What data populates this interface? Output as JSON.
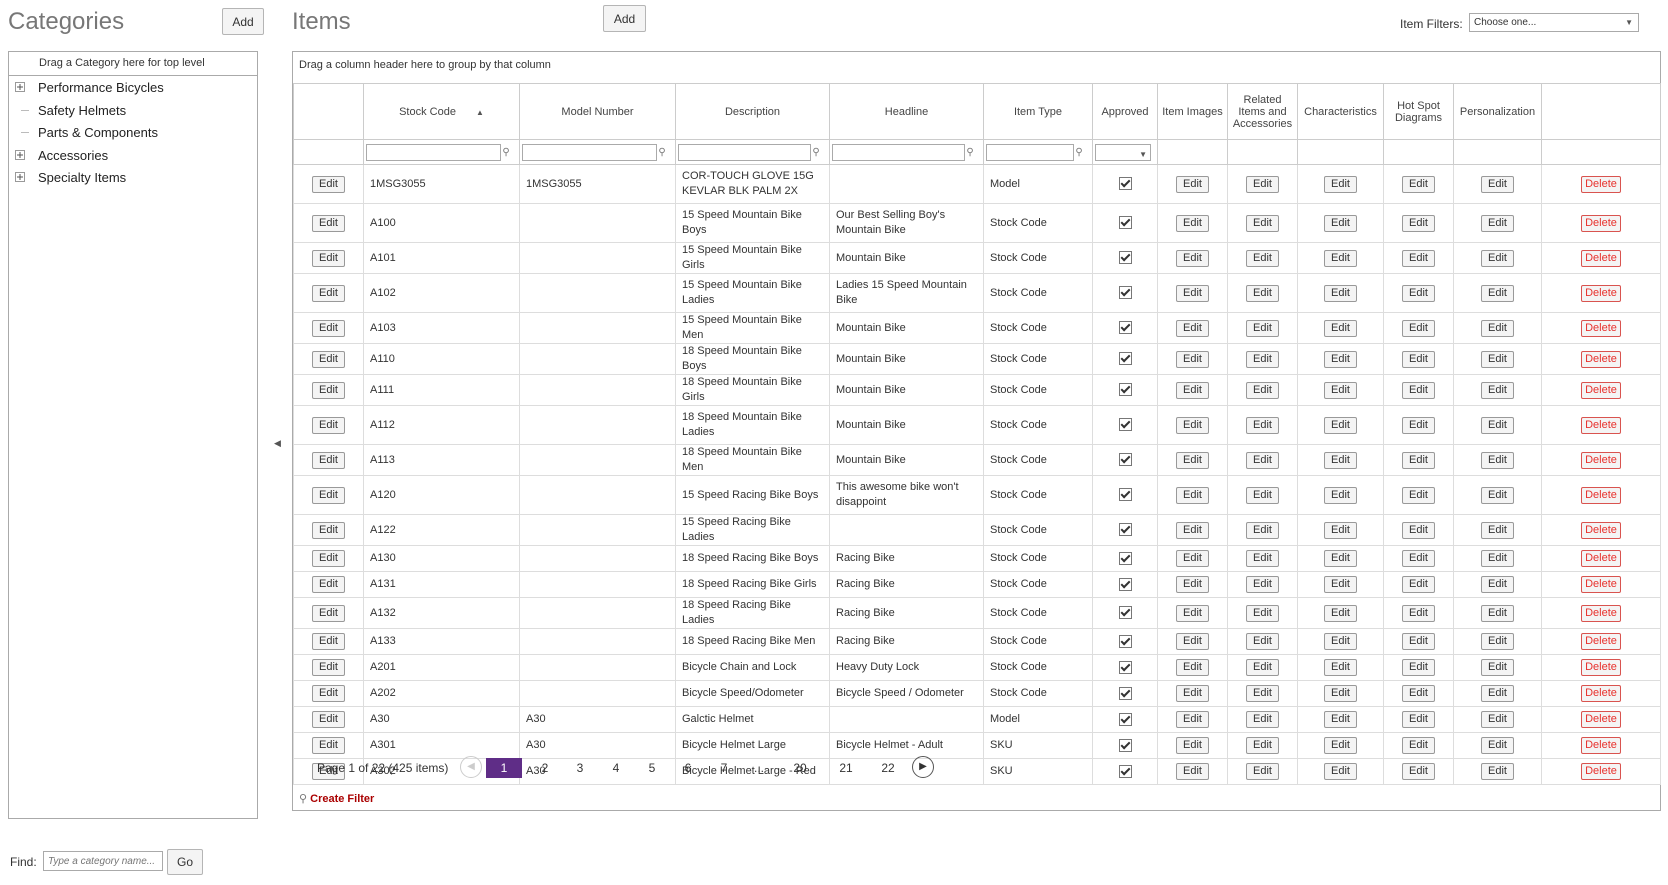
{
  "categories": {
    "title": "Categories",
    "add_label": "Add",
    "drop_hint": "Drag a Category here for top level",
    "items": [
      {
        "label": "Performance Bicycles",
        "expandable": true
      },
      {
        "label": "Safety Helmets",
        "expandable": false
      },
      {
        "label": "Parts & Components",
        "expandable": false
      },
      {
        "label": "Accessories",
        "expandable": true
      },
      {
        "label": "Specialty Items",
        "expandable": true
      }
    ],
    "find_label": "Find:",
    "find_placeholder": "Type a category name...",
    "go_label": "Go"
  },
  "items": {
    "title": "Items",
    "add_label": "Add",
    "filter_label": "Item Filters:",
    "filter_value": "Choose one...",
    "group_hint": "Drag a column header here to group by that column",
    "columns": [
      "",
      "Stock Code",
      "Model Number",
      "Description",
      "Headline",
      "Item Type",
      "Approved",
      "Item Images",
      "Related Items and Accessories",
      "Characteristics",
      "Hot Spot Diagrams",
      "Personalization",
      ""
    ],
    "edit_label": "Edit",
    "delete_label": "Delete",
    "rows": [
      {
        "code": "1MSG3055",
        "model": "1MSG3055",
        "desc": "COR-TOUCH GLOVE 15G KEVLAR BLK PALM 2X",
        "headline": "",
        "type": "Model",
        "tall": true
      },
      {
        "code": "A100",
        "model": "",
        "desc": "15 Speed Mountain Bike Boys",
        "headline": "Our Best Selling Boy's Mountain Bike",
        "type": "Stock Code",
        "tall": true
      },
      {
        "code": "A101",
        "model": "",
        "desc": "15 Speed Mountain Bike Girls",
        "headline": "Mountain Bike",
        "type": "Stock Code",
        "tall": false
      },
      {
        "code": "A102",
        "model": "",
        "desc": "15 Speed Mountain Bike Ladies",
        "headline": "Ladies 15 Speed Mountain Bike",
        "type": "Stock Code",
        "tall": true
      },
      {
        "code": "A103",
        "model": "",
        "desc": "15 Speed Mountain Bike Men",
        "headline": "Mountain Bike",
        "type": "Stock Code",
        "tall": false
      },
      {
        "code": "A110",
        "model": "",
        "desc": "18 Speed Mountain Bike Boys",
        "headline": "Mountain Bike",
        "type": "Stock Code",
        "tall": false
      },
      {
        "code": "A111",
        "model": "",
        "desc": "18 Speed Mountain Bike Girls",
        "headline": "Mountain Bike",
        "type": "Stock Code",
        "tall": false
      },
      {
        "code": "A112",
        "model": "",
        "desc": "18 Speed Mountain Bike Ladies",
        "headline": "Mountain Bike",
        "type": "Stock Code",
        "tall": true
      },
      {
        "code": "A113",
        "model": "",
        "desc": "18 Speed Mountain Bike Men",
        "headline": "Mountain Bike",
        "type": "Stock Code",
        "tall": false
      },
      {
        "code": "A120",
        "model": "",
        "desc": "15 Speed Racing Bike Boys",
        "headline": "This awesome bike won't disappoint",
        "type": "Stock Code",
        "tall": true
      },
      {
        "code": "A122",
        "model": "",
        "desc": "15 Speed Racing Bike Ladies",
        "headline": "",
        "type": "Stock Code",
        "tall": false
      },
      {
        "code": "A130",
        "model": "",
        "desc": "18 Speed Racing Bike Boys",
        "headline": "Racing Bike",
        "type": "Stock Code",
        "tall": false
      },
      {
        "code": "A131",
        "model": "",
        "desc": "18 Speed Racing Bike Girls",
        "headline": "Racing Bike",
        "type": "Stock Code",
        "tall": false
      },
      {
        "code": "A132",
        "model": "",
        "desc": "18 Speed Racing Bike Ladies",
        "headline": "Racing Bike",
        "type": "Stock Code",
        "tall": false
      },
      {
        "code": "A133",
        "model": "",
        "desc": "18 Speed Racing Bike Men",
        "headline": "Racing Bike",
        "type": "Stock Code",
        "tall": false
      },
      {
        "code": "A201",
        "model": "",
        "desc": "Bicycle Chain and Lock",
        "headline": "Heavy Duty Lock",
        "type": "Stock Code",
        "tall": false
      },
      {
        "code": "A202",
        "model": "",
        "desc": "Bicycle Speed/Odometer",
        "headline": "Bicycle Speed / Odometer",
        "type": "Stock Code",
        "tall": false
      },
      {
        "code": "A30",
        "model": "A30",
        "desc": "Galctic Helmet",
        "headline": "",
        "type": "Model",
        "tall": false
      },
      {
        "code": "A301",
        "model": "A30",
        "desc": "Bicycle Helmet Large",
        "headline": "Bicycle Helmet - Adult",
        "type": "SKU",
        "tall": false
      },
      {
        "code": "A302",
        "model": "A30",
        "desc": "Bicycle Helmet Large - Red",
        "headline": "",
        "type": "SKU",
        "tall": false
      }
    ],
    "pager": {
      "info": "Page 1 of 22 (425 items)",
      "pages": [
        "1",
        "2",
        "3",
        "4",
        "5",
        "6",
        "7",
        "...",
        "20",
        "21",
        "22"
      ],
      "active": "1"
    },
    "create_filter": "Create Filter",
    "delete_color": "#e8312d",
    "active_page_color": "#5f2d87"
  }
}
